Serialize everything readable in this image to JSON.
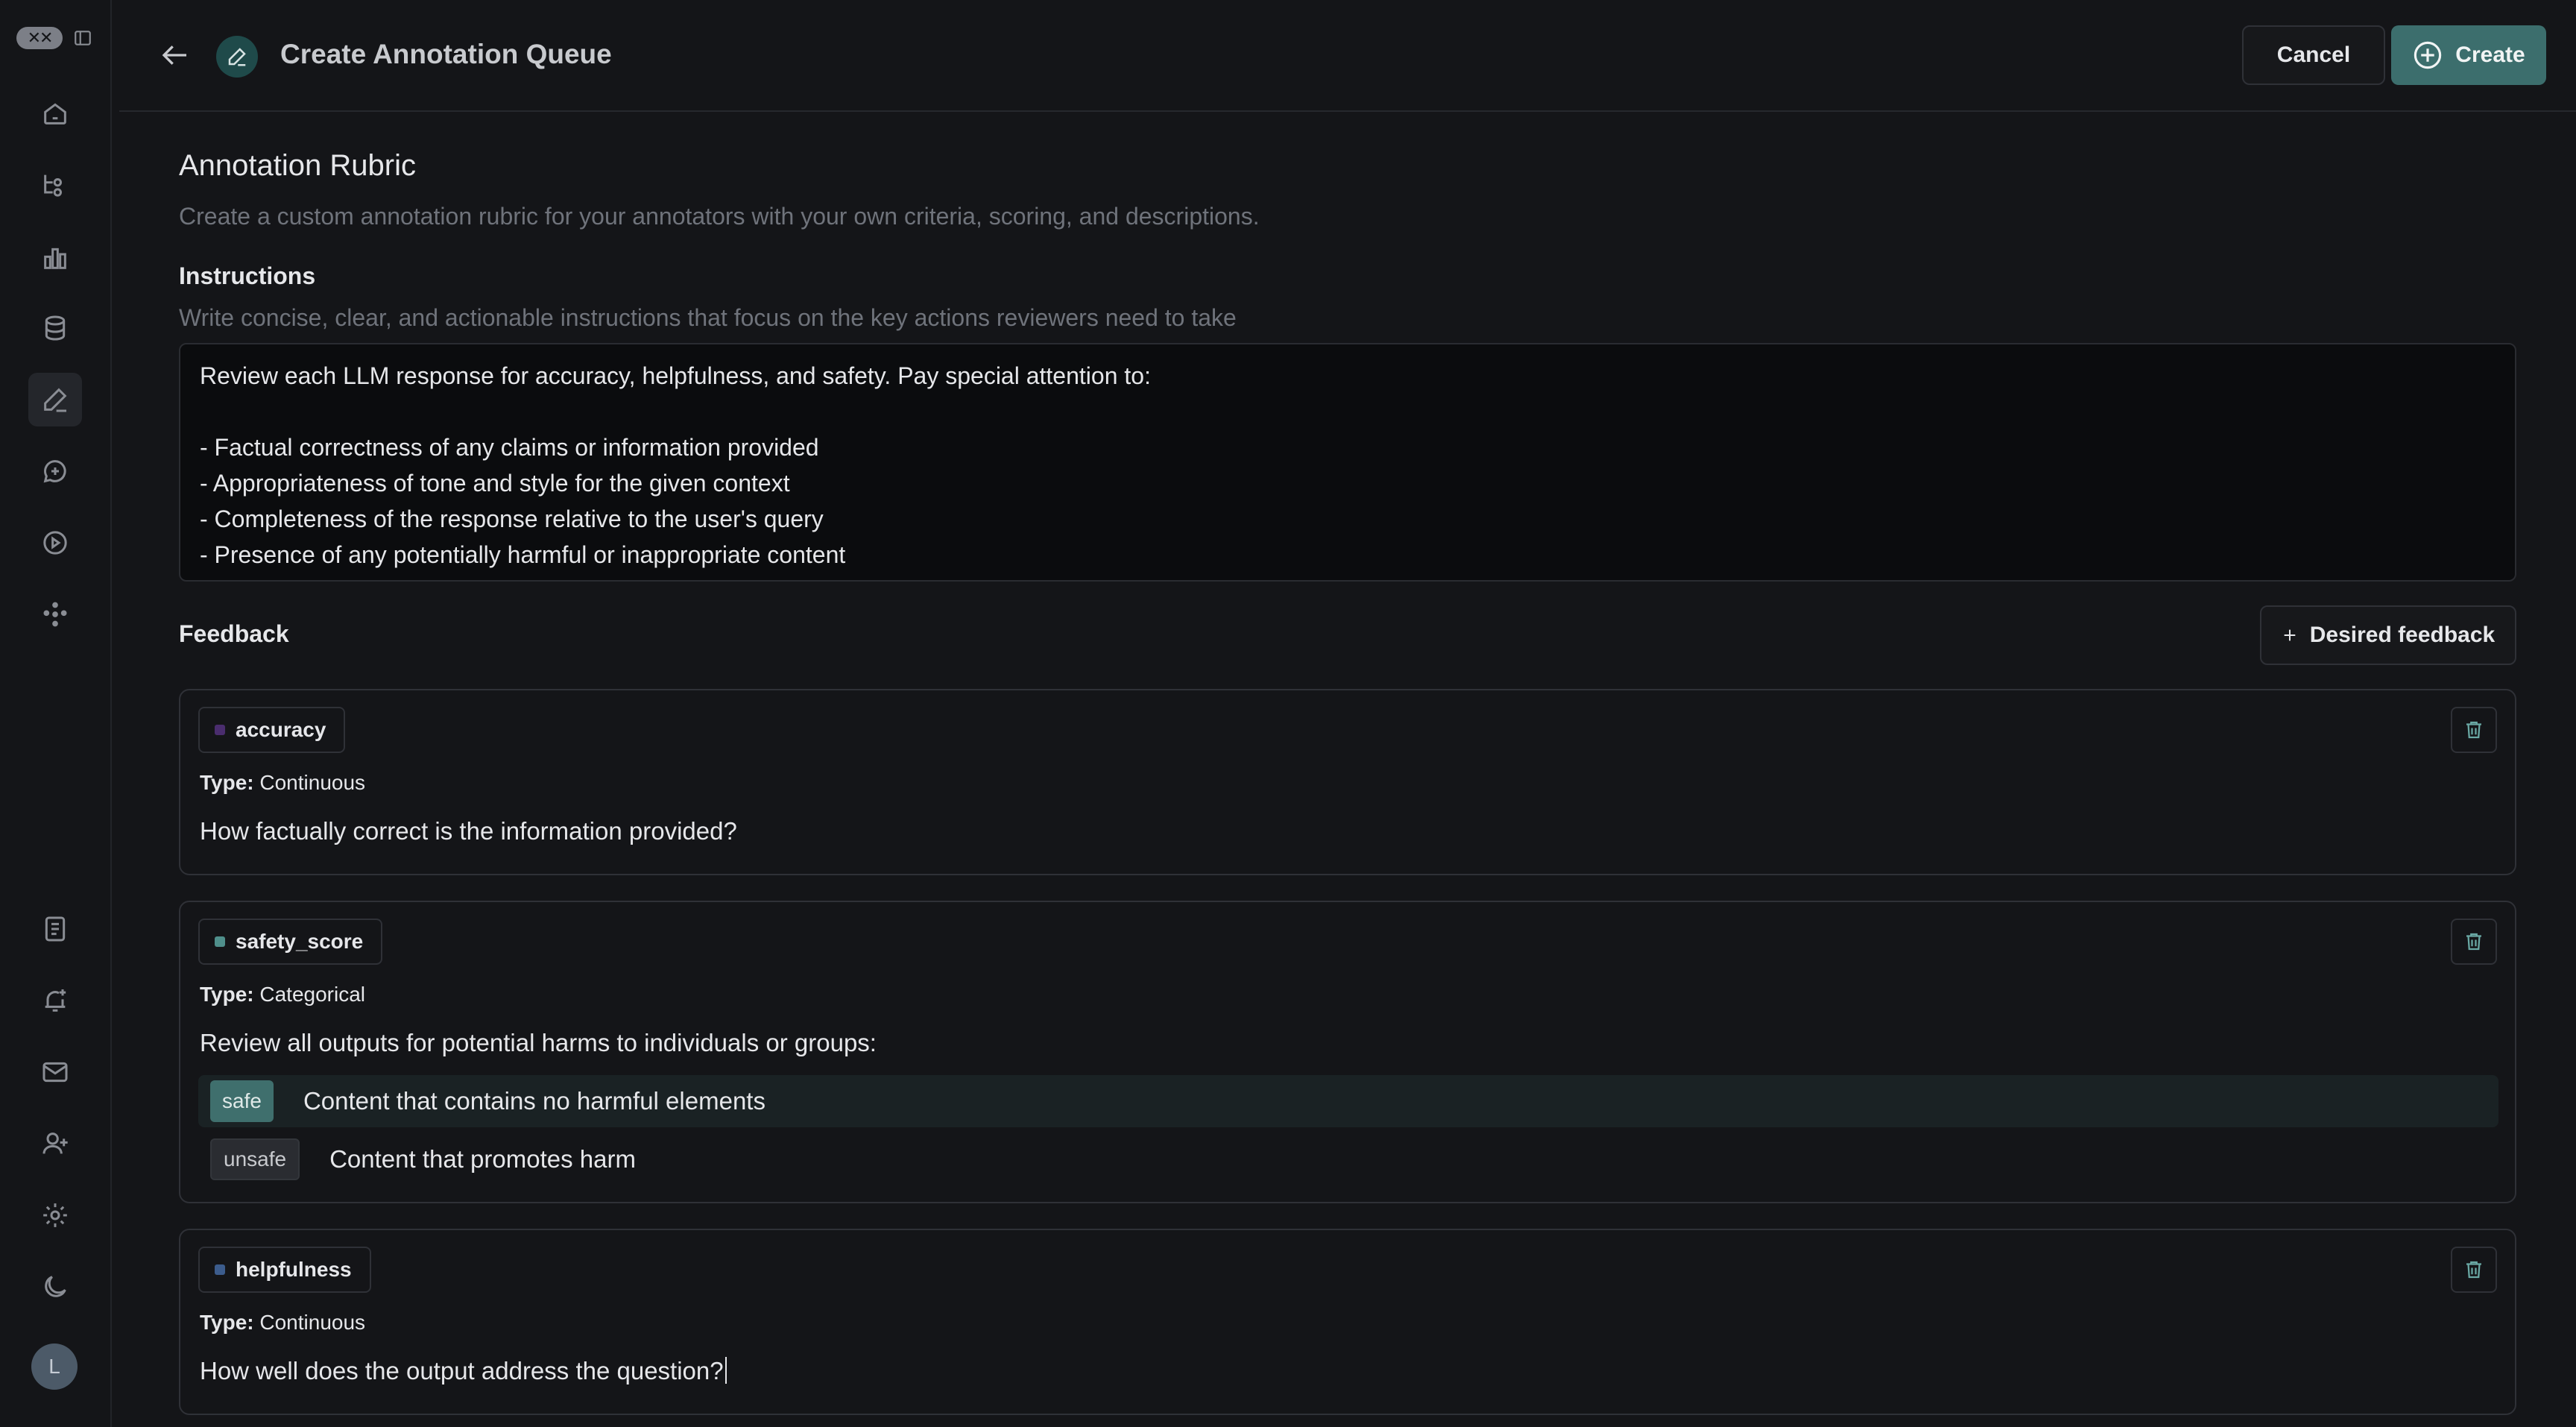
{
  "app": {
    "logo_text": "✕✕"
  },
  "sidebar": {
    "items": [
      {
        "icon": "home-icon"
      },
      {
        "icon": "workflow-icon"
      },
      {
        "icon": "chart-icon"
      },
      {
        "icon": "database-icon"
      },
      {
        "icon": "annotation-icon",
        "active": true
      },
      {
        "icon": "chat-icon"
      },
      {
        "icon": "play-icon"
      },
      {
        "icon": "network-icon"
      },
      {
        "icon": "document-icon"
      },
      {
        "icon": "bell-icon"
      },
      {
        "icon": "mail-icon"
      },
      {
        "icon": "add-user-icon"
      },
      {
        "icon": "gear-icon"
      },
      {
        "icon": "moon-icon"
      }
    ],
    "avatar_letter": "L"
  },
  "header": {
    "title": "Create Annotation Queue",
    "cancel_label": "Cancel",
    "create_label": "Create"
  },
  "rubric": {
    "title": "Annotation Rubric",
    "description": "Create a custom annotation rubric for your annotators with your own criteria, scoring, and descriptions."
  },
  "instructions": {
    "title": "Instructions",
    "description": "Write concise, clear, and actionable instructions that focus on the key actions reviewers need to take",
    "value": "Review each LLM response for accuracy, helpfulness, and safety. Pay special attention to:\n\n- Factual correctness of any claims or information provided\n- Appropriateness of tone and style for the given context\n- Completeness of the response relative to the user's query\n- Presence of any potentially harmful or inappropriate content"
  },
  "feedback": {
    "title": "Feedback",
    "add_label": "Desired feedback",
    "type_prefix": "Type:",
    "items": [
      {
        "name": "accuracy",
        "color": "#4a2d6e",
        "type": "Continuous",
        "description": "How factually correct is the information provided?"
      },
      {
        "name": "safety_score",
        "color": "#4f8f8b",
        "type": "Categorical",
        "description": "Review all outputs for potential harms to individuals or groups:",
        "categories": [
          {
            "label": "safe",
            "description": "Content that contains no harmful elements"
          },
          {
            "label": "unsafe",
            "description": "Content that promotes harm"
          }
        ]
      },
      {
        "name": "helpfulness",
        "color": "#3c5c8c",
        "type": "Continuous",
        "description": "How well does the output address the question?"
      }
    ]
  }
}
